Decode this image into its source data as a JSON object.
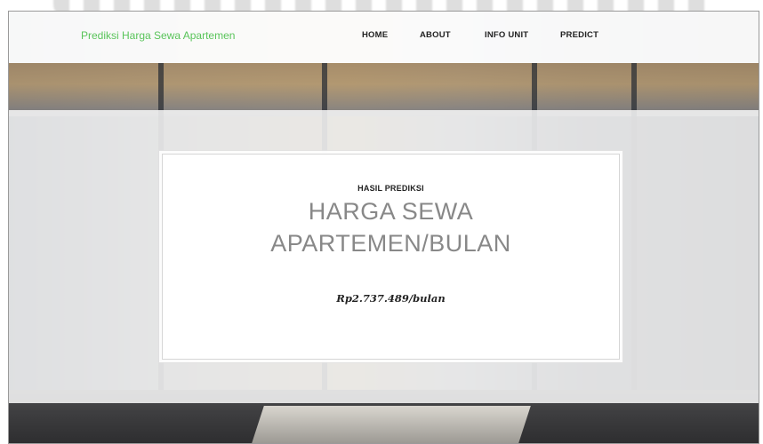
{
  "navbar": {
    "brand": "Prediksi Harga Sewa Apartemen",
    "links": [
      "HOME",
      "ABOUT",
      "INFO UNIT",
      "PREDICT"
    ]
  },
  "result_card": {
    "eyebrow": "HASIL PREDIKSI",
    "headline_line1": "HARGA SEWA",
    "headline_line2": "APARTEMEN/BULAN",
    "result_text": "Rp2.737.489/bulan"
  },
  "colors": {
    "brand": "#59c45a",
    "nav_text": "#222222",
    "headline": "#888888"
  }
}
